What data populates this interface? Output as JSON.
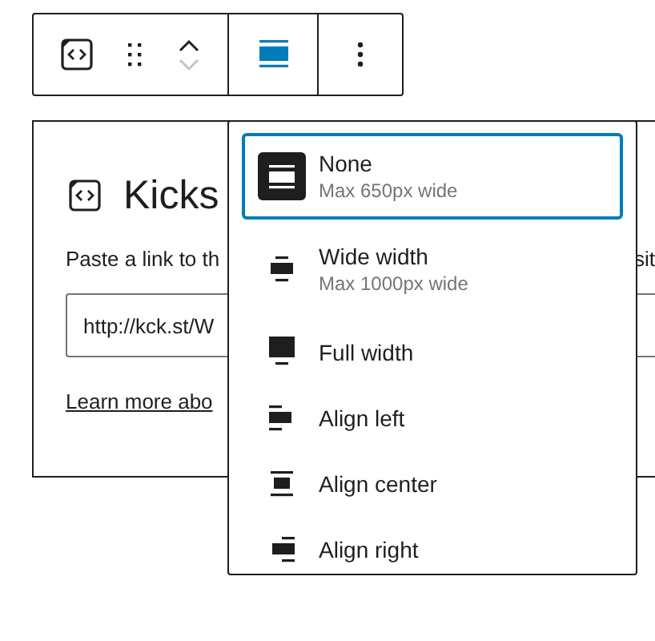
{
  "toolbar": {
    "move_up": {
      "disabled": false
    },
    "move_down": {
      "disabled": true
    },
    "align_button": {
      "selected": true
    }
  },
  "block": {
    "title": "Kicks",
    "description_left": "Paste a link to th",
    "description_right": "sit",
    "url_value": "http://kck.st/W",
    "learn_more": "Learn more abo"
  },
  "alignment_menu": {
    "items": [
      {
        "label": "None",
        "description": "Max 650px wide",
        "selected": true
      },
      {
        "label": "Wide width",
        "description": "Max 1000px wide",
        "selected": false
      },
      {
        "label": "Full width",
        "selected": false
      },
      {
        "label": "Align left",
        "selected": false
      },
      {
        "label": "Align center",
        "selected": false
      },
      {
        "label": "Align right",
        "selected": false
      }
    ]
  }
}
